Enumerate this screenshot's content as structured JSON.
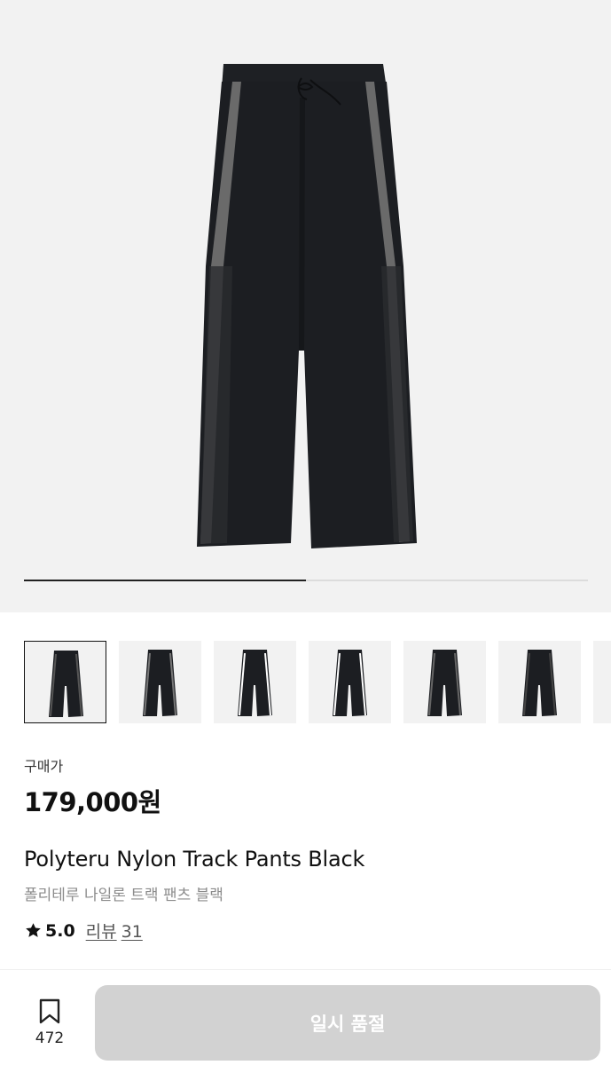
{
  "gallery": {
    "current_index": 1,
    "total_images": 2,
    "thumbnail_count": 7,
    "active_thumbnail": 1
  },
  "product": {
    "price_label": "구매가",
    "price": "179,000원",
    "name_en": "Polyteru Nylon Track Pants Black",
    "name_ko": "폴리테루 나일론 트랙 팬츠 블랙",
    "rating": "5.0",
    "reviews_label": "리뷰",
    "reviews_count": "31"
  },
  "bottom_bar": {
    "bookmark_count": "472",
    "buy_button_label": "일시 품절",
    "buy_button_state": "disabled"
  },
  "colors": {
    "hero_background": "#f2f2f2",
    "pants": "#1c1e22",
    "stripe": "#6a6a6a",
    "button_disabled": "#d2d2d2",
    "muted_text": "#8c8c8c"
  },
  "icons": [
    "star-icon",
    "bookmark-icon"
  ]
}
